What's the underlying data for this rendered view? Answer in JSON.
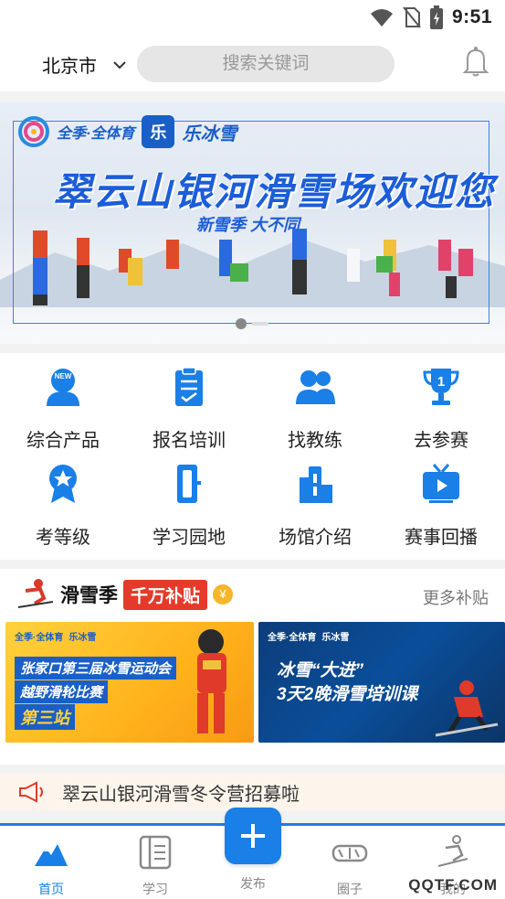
{
  "status_bar": {
    "time": "9:51"
  },
  "header": {
    "city": "北京市",
    "search_placeholder": "搜索关键词"
  },
  "banner": {
    "tagline": "全季·全体育",
    "brand": "乐冰雪",
    "title": "翠云山银河滑雪场欢迎您",
    "subtitle": "新雪季  大不同",
    "active_slide": 1,
    "slide_count": 2
  },
  "menu": {
    "items": [
      {
        "label": "综合产品",
        "icon": "new-badge-person-icon"
      },
      {
        "label": "报名培训",
        "icon": "clipboard-check-icon"
      },
      {
        "label": "找教练",
        "icon": "people-icon"
      },
      {
        "label": "去参赛",
        "icon": "trophy-icon"
      },
      {
        "label": "考等级",
        "icon": "medal-star-icon"
      },
      {
        "label": "学习园地",
        "icon": "door-icon"
      },
      {
        "label": "场馆介绍",
        "icon": "building-icon"
      },
      {
        "label": "赛事回播",
        "icon": "tv-play-icon"
      }
    ]
  },
  "promo": {
    "title": "滑雪季",
    "badge": "千万补贴",
    "coin": "¥",
    "more": "更多补贴",
    "cards": [
      {
        "tag": "全季·全体育",
        "brand": "乐冰雪",
        "line1": "张家口第三届冰雪运动会",
        "line2": "越野滑轮比赛",
        "line3": "第三站"
      },
      {
        "tag": "全季·全体育",
        "brand": "乐冰雪",
        "line1": "冰雪“大进”",
        "line2": "3天2晚滑雪培训课"
      }
    ]
  },
  "notice": {
    "text": "翠云山银河滑雪冬令营招募啦"
  },
  "tabbar": {
    "tabs": [
      {
        "label": "首页",
        "icon": "mountain-icon",
        "active": true
      },
      {
        "label": "学习",
        "icon": "notebook-icon",
        "active": false
      },
      {
        "label": "发布",
        "icon": "plus-icon",
        "active": false
      },
      {
        "label": "圈子",
        "icon": "goggles-icon",
        "active": false
      },
      {
        "label": "我的",
        "icon": "skier-icon",
        "active": false
      }
    ]
  },
  "watermark": "QQTF.COM",
  "colors": {
    "accent": "#1a7fe6",
    "badge_red": "#e53a2b",
    "brand_blue": "#1a5fc7"
  }
}
